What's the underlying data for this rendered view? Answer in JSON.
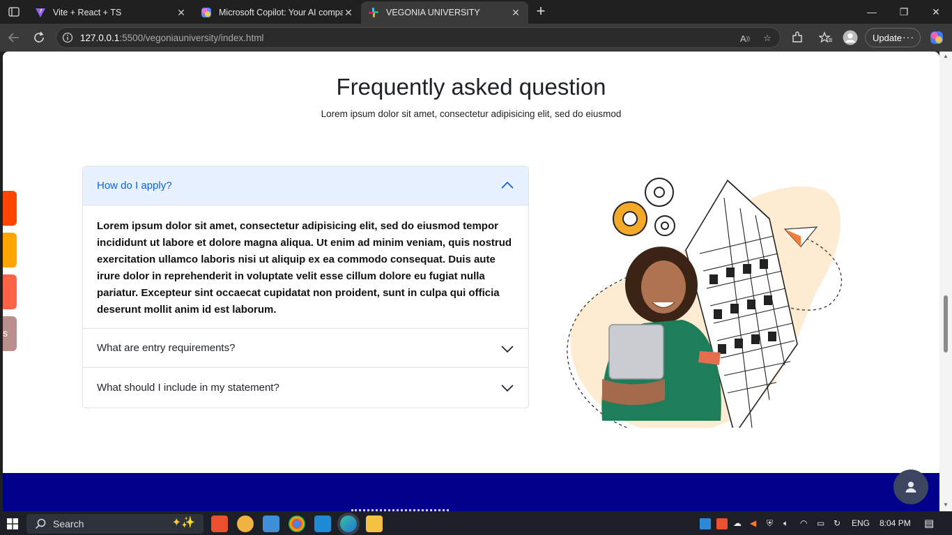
{
  "browser": {
    "tabs": [
      {
        "title": "Vite + React + TS",
        "active": false
      },
      {
        "title": "Microsoft Copilot: Your AI compa",
        "active": false
      },
      {
        "title": "VEGONIA UNIVERSITY",
        "active": true
      }
    ],
    "url_host": "127.0.0.1",
    "url_path": ":5500/vegoniauniversity/index.html",
    "update_label": "Update"
  },
  "faq": {
    "title": "Frequently asked question",
    "subtitle": "Lorem ipsum dolor sit amet, consectetur adipisicing elit, sed do eiusmod",
    "items": [
      {
        "question": "How do I apply?",
        "expanded": true,
        "answer": "Lorem ipsum dolor sit amet, consectetur adipisicing elit, sed do eiusmod tempor incididunt ut labore et dolore magna aliqua. Ut enim ad minim veniam, quis nostrud exercitation ullamco laboris nisi ut aliquip ex ea commodo consequat. Duis aute irure dolor in reprehenderit in voluptate velit esse cillum dolore eu fugiat nulla pariatur. Excepteur sint occaecat cupidatat non proident, sunt in culpa qui officia deserunt mollit anim id est laborum."
      },
      {
        "question": "What are entry requirements?",
        "expanded": false
      },
      {
        "question": "What should I include in my statement?",
        "expanded": false
      }
    ]
  },
  "side_tabs": [
    {
      "color": "#ff4500",
      "label": ""
    },
    {
      "color": "#ffa500",
      "label": ""
    },
    {
      "color": "#ff6347",
      "label": ""
    },
    {
      "color": "#bc8f8f",
      "label": "s"
    }
  ],
  "colors": {
    "accordion_open_bg": "#e7f1ff",
    "accordion_open_text": "#0c63e4",
    "footer_band": "#00008b",
    "fab": "#3d4660"
  },
  "taskbar": {
    "search_placeholder": "Search",
    "language": "ENG",
    "time": "8:04 PM"
  }
}
